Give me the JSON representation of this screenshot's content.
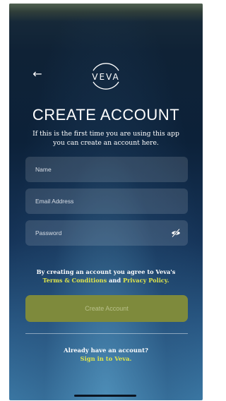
{
  "header": {
    "back_icon": "arrow-left-icon",
    "logo_text": "VEVA"
  },
  "main": {
    "title": "CREATE ACCOUNT",
    "subtitle": "If this is the first time you are using this app you can create an account here."
  },
  "form": {
    "name_placeholder": "Name",
    "email_placeholder": "Email Address",
    "password_placeholder": "Password",
    "password_toggle_icon": "eye-off-icon"
  },
  "terms": {
    "prefix": "By creating an account you agree to Veva's",
    "terms_link": "Terms & Conditions",
    "conjunction": "and",
    "privacy_link": "Privacy Policy."
  },
  "actions": {
    "create_label": "Create Account"
  },
  "footer": {
    "already_text": "Already have an account?",
    "signin_link": "Sign in to Veva."
  },
  "colors": {
    "accent": "#dfe54c",
    "button_bg": "#7e8a3c"
  }
}
